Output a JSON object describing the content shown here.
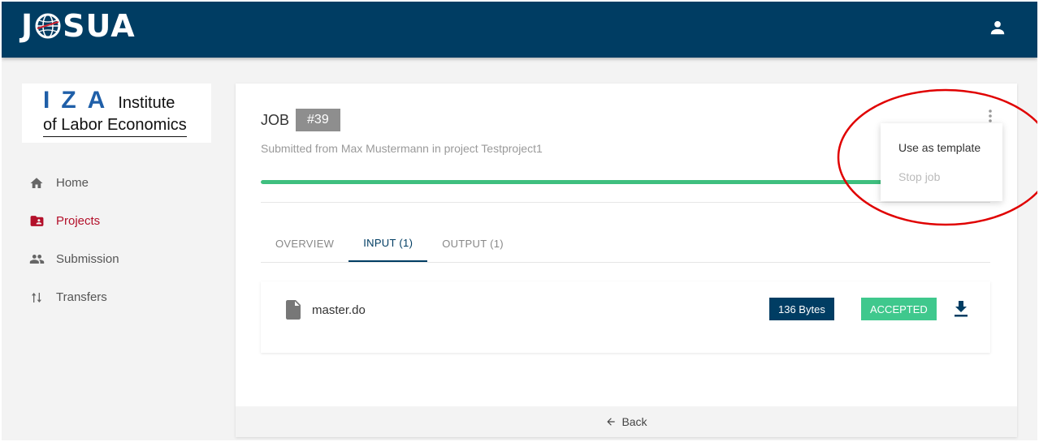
{
  "app": {
    "logo_text": "J SUA",
    "brand_color": "#003d63"
  },
  "header": {
    "user_icon": "account-icon"
  },
  "org_logo": {
    "letters": "IZA",
    "word": "Institute",
    "line2": "of Labor Economics"
  },
  "sidebar": {
    "items": [
      {
        "label": "Home",
        "icon": "home-icon"
      },
      {
        "label": "Projects",
        "icon": "folder-shared-icon",
        "active": true
      },
      {
        "label": "Submission",
        "icon": "people-icon"
      },
      {
        "label": "Transfers",
        "icon": "transfer-arrows-icon"
      }
    ]
  },
  "job": {
    "label": "JOB",
    "id": "#39",
    "subtitle": "Submitted from Max Mustermann in project Testproject1",
    "progress": 1.0
  },
  "tabs": [
    {
      "label": "OVERVIEW"
    },
    {
      "label": "INPUT (1)",
      "active": true
    },
    {
      "label": "OUTPUT (1)"
    }
  ],
  "file": {
    "name": "master.do",
    "size": "136 Bytes",
    "status": "ACCEPTED",
    "status_color": "#3fc88d"
  },
  "menu": {
    "items": [
      {
        "label": "Use as template",
        "enabled": true
      },
      {
        "label": "Stop job",
        "enabled": false
      }
    ]
  },
  "footer": {
    "back_label": "Back"
  },
  "annotation_color": "#e00000"
}
